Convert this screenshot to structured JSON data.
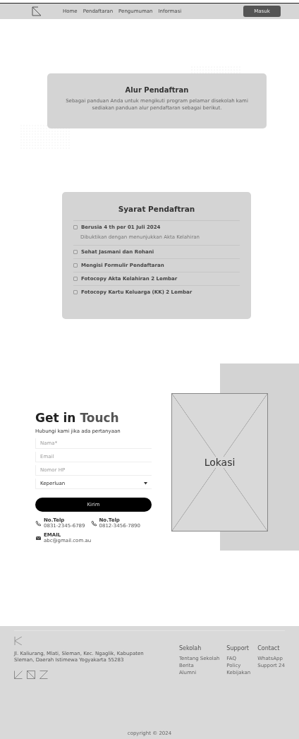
{
  "nav": {
    "links": [
      {
        "label": "Home",
        "selected": false
      },
      {
        "label": "Pendaftaran",
        "selected": false
      },
      {
        "label": "Pengumuman",
        "selected": false
      },
      {
        "label": "Informasi",
        "selected": false
      }
    ],
    "button": "Masuk"
  },
  "alur": {
    "title": "Alur Pendaftran",
    "text": "Sebagai panduan Anda untuk mengikuti program pelamar disekolah kami sediakan panduan alur pendaftaran sebagai berikut."
  },
  "syarat": {
    "title": "Syarat Pendaftran",
    "items": [
      {
        "label": "Berusia 4 th per 01 Juli 2024",
        "note": "Dibuktikan dengan menunjukkan Akta Kelahiran",
        "checked": false
      },
      {
        "label": "Sehat Jasmani dan Rohani",
        "checked": false
      },
      {
        "label": "Mengisi Formulir Pendaftaran",
        "checked": false
      },
      {
        "label": "Fotocopy Akta Kelahiran 2 Lembar",
        "checked": false
      },
      {
        "label": "Fotocopy Kartu Keluarga (KK) 2 Lembar",
        "checked": false
      }
    ]
  },
  "contact": {
    "title_a": "Get in",
    "title_b": "Touch",
    "subtitle": "Hubungi kami jika ada pertanyaan",
    "fields": [
      {
        "kind": "text",
        "placeholder": "Nama*"
      },
      {
        "kind": "text",
        "placeholder": "Email"
      },
      {
        "kind": "text",
        "placeholder": "Nomor HP"
      },
      {
        "kind": "select",
        "value": "Keperluan"
      }
    ],
    "button": "Kirim",
    "infos": [
      {
        "kind": "phone",
        "label": "No.Telp",
        "value": "0831-2345-6789"
      },
      {
        "kind": "phone",
        "label": "No.Telp",
        "value": "0812-3456-7890"
      },
      {
        "kind": "mail",
        "label": "EMAIL",
        "value": "abc@gmail.com.au"
      }
    ],
    "map_label": "Lokasi"
  },
  "footer": {
    "address": "Jl. Kaliurang, Mlati, Sleman, Kec. Ngaglik, Kabupaten Sleman, Daerah Istimewa Yogyakarta 55283",
    "columns": [
      {
        "title": "Sekolah",
        "links": [
          "Tentang Sekolah",
          "Berita",
          "Alumni"
        ]
      },
      {
        "title": "Support",
        "links": [
          "FAQ",
          "Policy",
          "Kebijakan"
        ]
      },
      {
        "title": "Contact",
        "links": [
          "WhatsApp",
          "Support 24"
        ]
      }
    ],
    "copyright": "copyright © 2024"
  }
}
